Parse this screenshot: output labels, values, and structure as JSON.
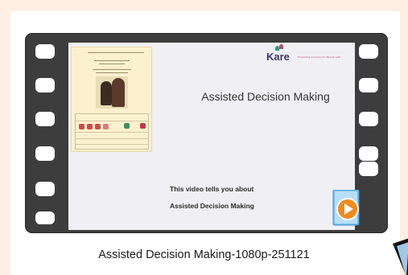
{
  "file": {
    "name": "Assisted Decision Making-1080p-251121",
    "type_icon": "windows-media-player-icon"
  },
  "thumbnail": {
    "brand": "Kare",
    "brand_tagline": "Promoting inclusion for People with...",
    "slide_title": "Assisted Decision Making",
    "slide_note_line1": "This video tells you about",
    "slide_note_line2": "Assisted Decision Making",
    "embedded_doc_icon": "easy-read-document-icon"
  },
  "colors": {
    "tile_background": "#fdefe3",
    "film_strip": "#3d3d3d",
    "player_orange": "#f08a1c",
    "player_blue": "#4aa3e0",
    "kare_text": "#3c3568"
  }
}
